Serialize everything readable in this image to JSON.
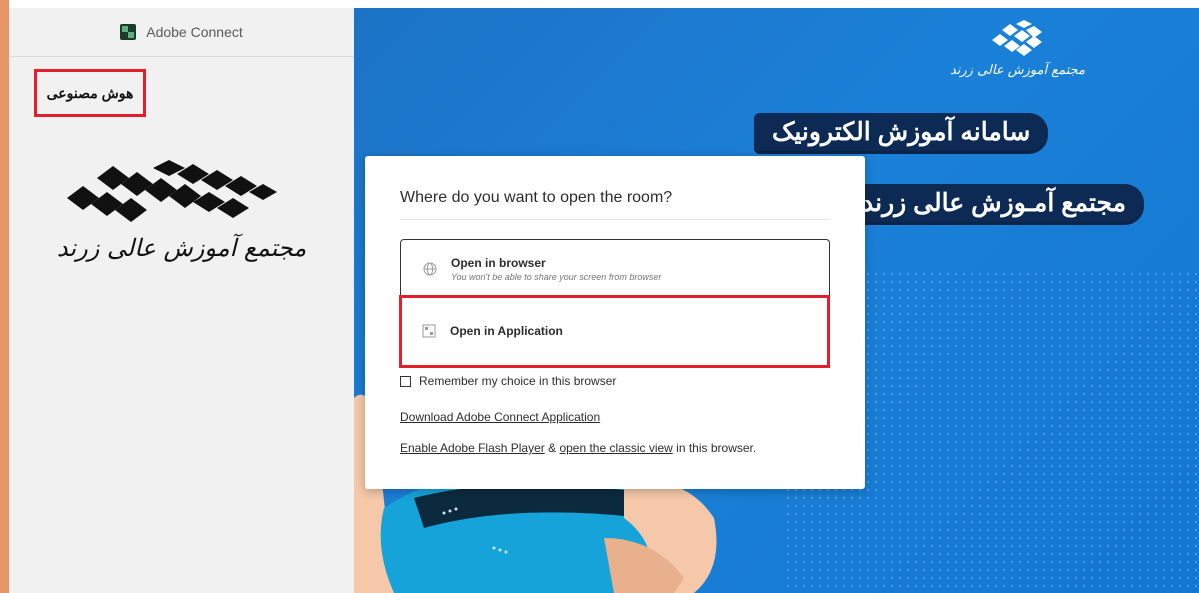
{
  "sidebar": {
    "app_title": "Adobe Connect",
    "room_name": "هوش مصنوعی",
    "logo_text": "مجتمع آموزش عالی زرند"
  },
  "banner": {
    "brand_text": "مجتمع آموزش عالی زرند",
    "headline_1": "سامانه آموزش الکترونیک",
    "headline_2": "مجتمع آمـوزش عالی زرند",
    "colors": {
      "background": "#1b7ed6",
      "pill": "#0d2a55"
    }
  },
  "dialog": {
    "title": "Where do you want to open the room?",
    "options": [
      {
        "label": "Open in browser",
        "sublabel": "You won't be able to share your screen from browser",
        "icon": "globe-icon"
      },
      {
        "label": "Open in Application",
        "icon": "app-window-icon"
      }
    ],
    "remember_label": "Remember my choice in this browser",
    "download_link": "Download Adobe Connect Application",
    "flash_link": "Enable Adobe Flash Player",
    "flash_sep": " & ",
    "classic_link": "open the classic view",
    "flash_suffix": " in this browser."
  },
  "annotation_color": "#e41e2b"
}
